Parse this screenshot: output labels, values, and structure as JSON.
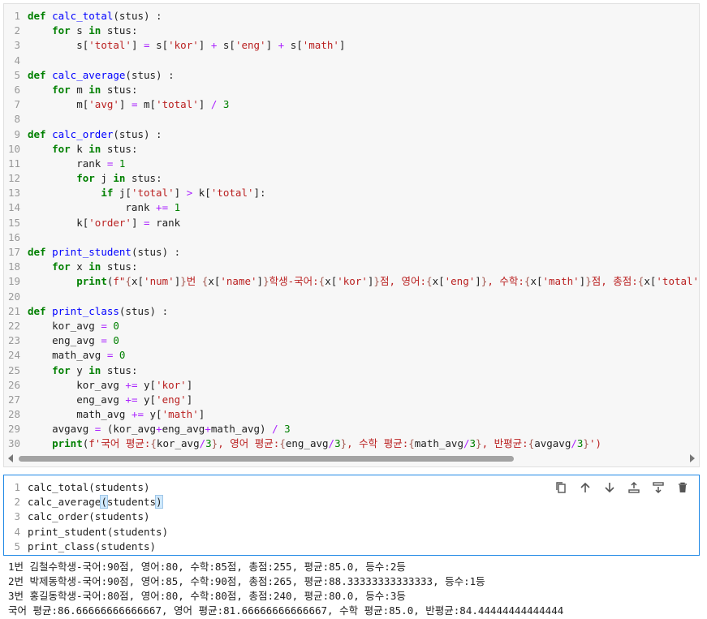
{
  "cell1": {
    "lines": [
      {
        "n": "1",
        "html": "<span class='kw'>def</span> <span class='fn'>calc_total</span>(stus) :"
      },
      {
        "n": "2",
        "html": "    <span class='kw'>for</span> s <span class='kw'>in</span> stus:"
      },
      {
        "n": "3",
        "html": "        s[<span class='st'>'total'</span>] <span class='op'>=</span> s[<span class='st'>'kor'</span>] <span class='op'>+</span> s[<span class='st'>'eng'</span>] <span class='op'>+</span> s[<span class='st'>'math'</span>]"
      },
      {
        "n": "4",
        "html": ""
      },
      {
        "n": "5",
        "html": "<span class='kw'>def</span> <span class='fn'>calc_average</span>(stus) :"
      },
      {
        "n": "6",
        "html": "    <span class='kw'>for</span> m <span class='kw'>in</span> stus:"
      },
      {
        "n": "7",
        "html": "        m[<span class='st'>'avg'</span>] <span class='op'>=</span> m[<span class='st'>'total'</span>] <span class='op'>/</span> <span class='nu'>3</span>"
      },
      {
        "n": "8",
        "html": ""
      },
      {
        "n": "9",
        "html": "<span class='kw'>def</span> <span class='fn'>calc_order</span>(stus) :"
      },
      {
        "n": "10",
        "html": "    <span class='kw'>for</span> k <span class='kw'>in</span> stus:"
      },
      {
        "n": "11",
        "html": "        rank <span class='op'>=</span> <span class='nu'>1</span>"
      },
      {
        "n": "12",
        "html": "        <span class='kw'>for</span> j <span class='kw'>in</span> stus:"
      },
      {
        "n": "13",
        "html": "            <span class='kw'>if</span> j[<span class='st'>'total'</span>] <span class='op'>&gt;</span> k[<span class='st'>'total'</span>]:"
      },
      {
        "n": "14",
        "html": "                rank <span class='op'>+=</span> <span class='nu'>1</span>"
      },
      {
        "n": "15",
        "html": "        k[<span class='st'>'order'</span>] <span class='op'>=</span> rank"
      },
      {
        "n": "16",
        "html": ""
      },
      {
        "n": "17",
        "html": "<span class='kw'>def</span> <span class='fn'>print_student</span>(stus) :"
      },
      {
        "n": "18",
        "html": "    <span class='kw'>for</span> x <span class='kw'>in</span> stus:"
      },
      {
        "n": "19",
        "html": "        <span class='kw'>print</span>(<span class='st'>f\"</span><span class='fx'>{</span>x[<span class='st'>'num'</span>]<span class='fx'>}</span><span class='st'>번 </span><span class='fx'>{</span>x[<span class='st'>'name'</span>]<span class='fx'>}</span><span class='st'>학생-국어:</span><span class='fx'>{</span>x[<span class='st'>'kor'</span>]<span class='fx'>}</span><span class='st'>점, 영어:</span><span class='fx'>{</span>x[<span class='st'>'eng'</span>]<span class='fx'>}</span><span class='st'>, 수학:</span><span class='fx'>{</span>x[<span class='st'>'math'</span>]<span class='fx'>}</span><span class='st'>점, 총점:</span><span class='fx'>{</span>x[<span class='st'>'total'</span>"
      },
      {
        "n": "20",
        "html": ""
      },
      {
        "n": "21",
        "html": "<span class='kw'>def</span> <span class='fn'>print_class</span>(stus) :"
      },
      {
        "n": "22",
        "html": "    kor_avg <span class='op'>=</span> <span class='nu'>0</span>"
      },
      {
        "n": "23",
        "html": "    eng_avg <span class='op'>=</span> <span class='nu'>0</span>"
      },
      {
        "n": "24",
        "html": "    math_avg <span class='op'>=</span> <span class='nu'>0</span>"
      },
      {
        "n": "25",
        "html": "    <span class='kw'>for</span> y <span class='kw'>in</span> stus:"
      },
      {
        "n": "26",
        "html": "        kor_avg <span class='op'>+=</span> y[<span class='st'>'kor'</span>]"
      },
      {
        "n": "27",
        "html": "        eng_avg <span class='op'>+=</span> y[<span class='st'>'eng'</span>]"
      },
      {
        "n": "28",
        "html": "        math_avg <span class='op'>+=</span> y[<span class='st'>'math'</span>]"
      },
      {
        "n": "29",
        "html": "    avgavg <span class='op'>=</span> (kor_avg<span class='op'>+</span>eng_avg<span class='op'>+</span>math_avg) <span class='op'>/</span> <span class='nu'>3</span>"
      },
      {
        "n": "30",
        "html": "    <span class='kw'>print</span>(<span class='st'>f'국어 평균:</span><span class='fx'>{</span>kor_avg<span class='op'>/</span><span class='nu'>3</span><span class='fx'>}</span><span class='st'>, 영어 평균:</span><span class='fx'>{</span>eng_avg<span class='op'>/</span><span class='nu'>3</span><span class='fx'>}</span><span class='st'>, 수학 평균:</span><span class='fx'>{</span>math_avg<span class='op'>/</span><span class='nu'>3</span><span class='fx'>}</span><span class='st'>, 반평균:</span><span class='fx'>{</span>avgavg<span class='op'>/</span><span class='nu'>3</span><span class='fx'>}</span><span class='st'>')</span>"
      }
    ]
  },
  "cell2": {
    "lines": [
      {
        "n": "1",
        "html": "calc_total(students)"
      },
      {
        "n": "2",
        "html": "calc_average<span class='bracket-hl'>(</span>students<span class='bracket-hl'>)</span>"
      },
      {
        "n": "3",
        "html": "calc_order(students)"
      },
      {
        "n": "4",
        "html": "print_student(students)"
      },
      {
        "n": "5",
        "html": "print_class(students)"
      }
    ],
    "toolbar": {
      "icons": [
        "copy-icon",
        "arrow-up-icon",
        "arrow-down-icon",
        "insert-above-icon",
        "insert-below-icon",
        "trash-icon"
      ]
    }
  },
  "output": {
    "lines": [
      "1번 김철수학생-국어:90점, 영어:80, 수학:85점, 총점:255, 평균:85.0, 등수:2등",
      "2번 박제동학생-국어:90점, 영어:85, 수학:90점, 총점:265, 평균:88.33333333333333, 등수:1등",
      "3번 홍길동학생-국어:80점, 영어:80, 수학:80점, 총점:240, 평균:80.0, 등수:3등",
      "국어 평균:86.66666666666667, 영어 평균:81.66666666666667, 수학 평균:85.0, 반평균:84.44444444444444"
    ]
  }
}
